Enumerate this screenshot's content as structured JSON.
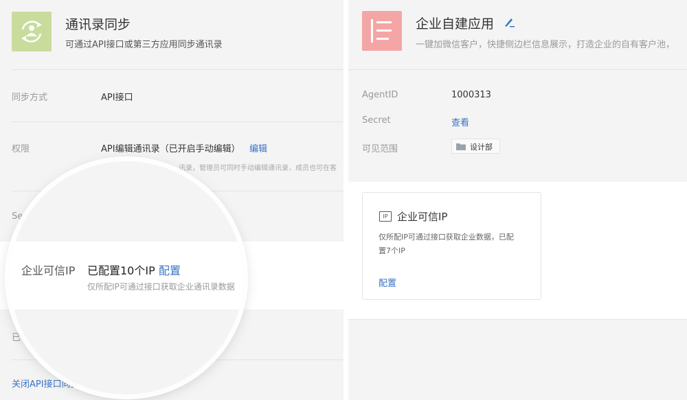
{
  "left": {
    "title": "通讯录同步",
    "subtitle": "可通过API接口或第三方应用同步通讯录",
    "sync_mode_label": "同步方式",
    "sync_mode_value": "API接口",
    "permission_label": "权限",
    "permission_value": "API编辑通讯录（已开启手动编辑）",
    "permission_edit": "编辑",
    "permission_hint": "讯录，管理员可同时手动编辑通讯录，成员也可在客",
    "secret_label_partial": "Sec",
    "configured_partial": "已讠",
    "close_link": "关闭API接口同步",
    "trusted_ip_label": "企业可信IP",
    "trusted_ip_value": "已配置10个IP",
    "trusted_ip_config": "配置",
    "trusted_ip_hint": "仅所配IP可通过接口获取企业通讯录数据"
  },
  "right": {
    "title": "企业自建应用",
    "subtitle": "一键加微信客户，快捷侧边栏信息展示，打造企业的自有客户池，",
    "agentid_label": "AgentID",
    "agentid_value": "1000313",
    "secret_label": "Secret",
    "secret_view": "查看",
    "visible_label": "可见范围",
    "visible_tag": "设计部",
    "card": {
      "badge": "IP",
      "title": "企业可信IP",
      "desc_line1": "仅所配IP可通过接口获取企业数据，已配",
      "desc_line2": "置7个IP",
      "config": "配置"
    }
  },
  "colors": {
    "sync_icon_bg": "#c8dd9c",
    "app_icon_bg": "#f4a5a5",
    "link": "#3a72c4"
  }
}
